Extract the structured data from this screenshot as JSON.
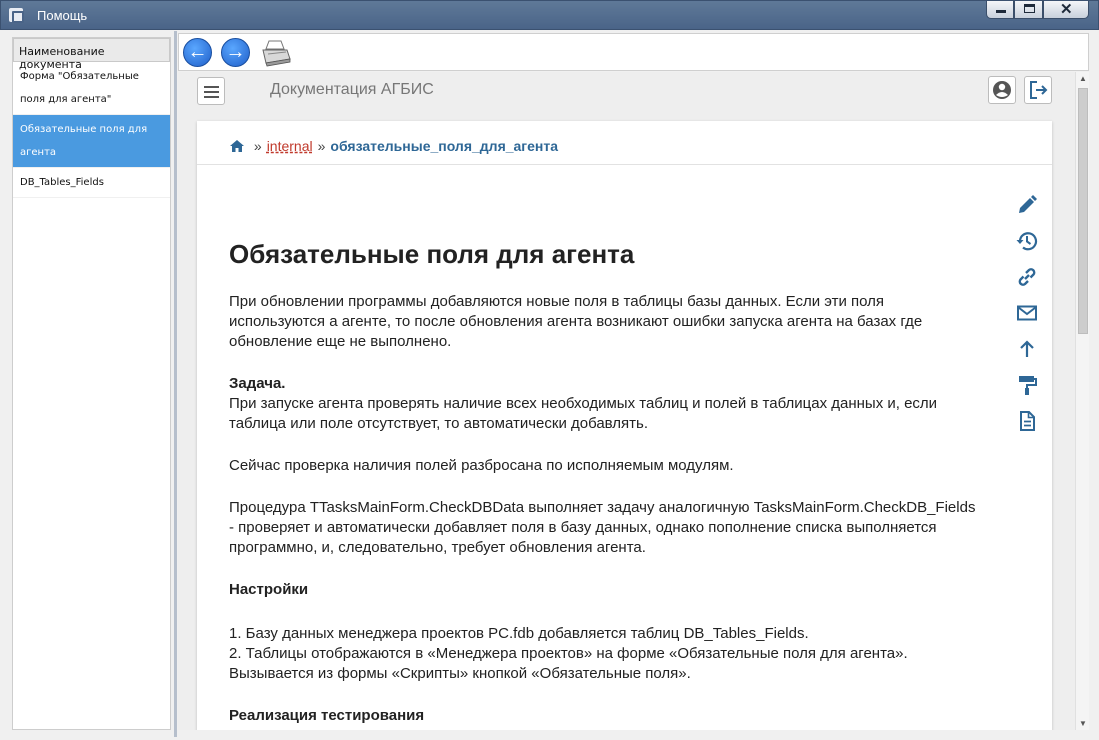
{
  "window": {
    "title": "Помощь"
  },
  "left_panel": {
    "header": "Наименование документа",
    "items": [
      {
        "label": "Форма \"Обязательные поля для агента\""
      },
      {
        "label": "Обязательные поля для агента",
        "selected": true
      },
      {
        "label": "DB_Tables_Fields"
      }
    ]
  },
  "topnav": {
    "site_title": "Документация АГБИС"
  },
  "breadcrumb": {
    "separator": "»",
    "link": "internal",
    "current": "обязательные_поля_для_агента"
  },
  "article": {
    "title": "Обязательные поля для агента",
    "intro": "При обновлении программы добавляются новые поля в таблицы базы данных. Если эти поля используются а агенте, то после обновления агента возникают ошибки запуска агента на базах где обновление еще не выполнено.",
    "task_heading": "Задача.",
    "task_text": "При запуске агента проверять наличие всех необходимых таблиц и полей в таблицах данных и, если таблица или поле отсутствует, то автоматически добавлять.",
    "para_current": "Сейчас проверка наличия полей разбросана по исполняемым модулям.",
    "para_procedure": "Процедура TTasksMainForm.CheckDBData выполняет задачу аналогичную TasksMainForm.CheckDB_Fields - проверяет и автоматически добавляет поля в базу данных, однако пополнение списка выполняется программно, и, следовательно, требует обновления агента.",
    "settings_heading": "Настройки",
    "settings_line1": "1. Базу данных менеджера проектов PC.fdb добавляется таблиц DB_Tables_Fields.",
    "settings_line2": "2. Таблицы отображаются в «Менеджера проектов» на форме «Обязательные поля для агента».",
    "settings_line3": "Вызывается из формы «Скрипты» кнопкой «Обязательные поля».",
    "testing_heading": "Реализация тестирования"
  },
  "side_tools": [
    "edit-icon",
    "history-icon",
    "link-icon",
    "mail-icon",
    "arrow-up-icon",
    "paint-roller-icon",
    "document-icon"
  ],
  "colors": {
    "accent": "#4a9ae0",
    "link": "#2e6796",
    "icon": "#2e6796",
    "titlebar": "#4a6488"
  }
}
